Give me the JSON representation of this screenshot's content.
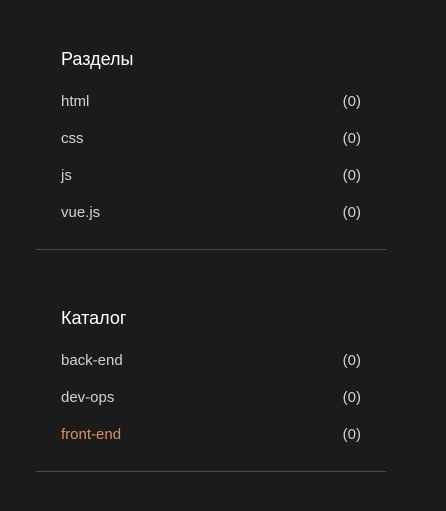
{
  "sections": [
    {
      "title": "Разделы",
      "items": [
        {
          "label": "html",
          "count": "(0)"
        },
        {
          "label": "css",
          "count": "(0)"
        },
        {
          "label": "js",
          "count": "(0)"
        },
        {
          "label": "vue.js",
          "count": "(0)"
        }
      ]
    },
    {
      "title": "Каталог",
      "items": [
        {
          "label": "back-end",
          "count": "(0)"
        },
        {
          "label": "dev-ops",
          "count": "(0)"
        },
        {
          "label": "front-end",
          "count": "(0)"
        }
      ]
    }
  ],
  "colors": {
    "background": "#1b1b1b",
    "text": "#d2d2d2",
    "title": "#ffffff",
    "active": "#d9925f",
    "divider": "#4a4a4a"
  }
}
